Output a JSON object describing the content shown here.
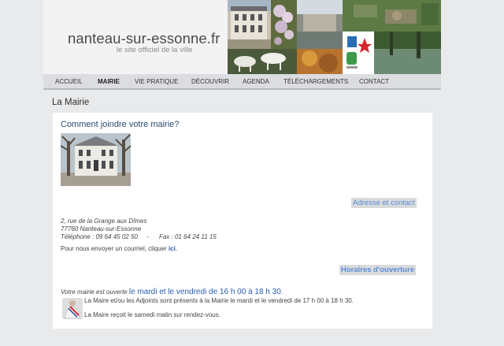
{
  "header": {
    "site_name": "nanteau-sur-essonne.fr",
    "tagline": "le site officiel de la ville"
  },
  "nav": {
    "items": [
      "ACCUEIL",
      "MAIRIE",
      "VIE PRATIQUE",
      "DÉCOUVRIR",
      "AGENDA",
      "TÉLÉCHARGEMENTS",
      "CONTACT"
    ],
    "active": "MAIRIE"
  },
  "page": {
    "title": "La Mairie"
  },
  "content": {
    "heading": "Comment joindre votre mairie?",
    "address_section": {
      "label": "Adresse et contact",
      "street": "2, rue de la Grange aux Dîmes",
      "city": "77760 Nanteau-sur-Essonne",
      "phone": "Téléphone : 09 64 45 02 50     -      Fax : 01 64 24 11 15"
    },
    "email": {
      "prefix": "Pour nous envoyer un courriel, cliquer ",
      "link": "ici",
      "suffix": "."
    },
    "hours_section": {
      "label": "Horaires d'ouverture",
      "intro": "Votre mairie est ouverte ",
      "days": "le mardi et le vendredi de 16 h 00 à 18 h 30",
      "end": "."
    },
    "info_lines": [
      "La Maire et/ou les Adjoints sont présents à la Mairie le mardi et le vendredi de 17 h 00 à 18 h 30.",
      "La Maire reçoit le samedi matin sur rendez-vous."
    ]
  },
  "colors": {
    "accent_link": "#2a5db0",
    "section_header": "#5a8fd6",
    "title_blue": "#2b4a6f"
  }
}
